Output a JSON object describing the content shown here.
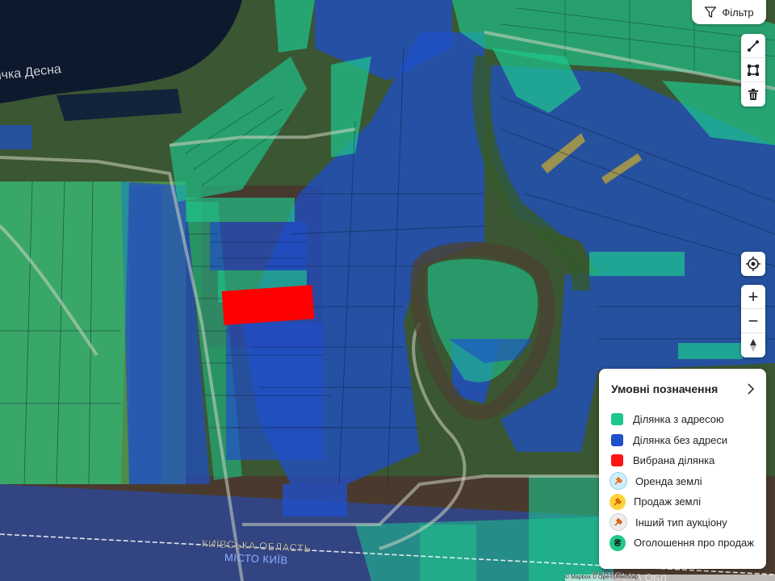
{
  "map": {
    "place_labels": {
      "river": "ічка Десна",
      "region": "КИЇВСЬКА ОБЛАСТЬ",
      "city": "МІСТО КИЇВ",
      "region_bottom": "КИЇВСЬКА ОБЛ"
    },
    "colors": {
      "with_address": "#1ec78e",
      "without_address": "#1f4fc9",
      "selected": "#ff0000"
    }
  },
  "toolbar": {
    "filter_label": "Фільтр",
    "filter_icon": "funnel-icon",
    "draw_icons": [
      "line-tool-icon",
      "polygon-tool-icon",
      "trash-icon"
    ],
    "locate_icon": "crosshair-icon",
    "zoom_in": "+",
    "zoom_out": "−",
    "compass_icon": "compass-icon"
  },
  "legend": {
    "title": "Умовні позначення",
    "items": [
      {
        "label": "Ділянка з адресою",
        "color": "#1ec78e",
        "kind": "swatch"
      },
      {
        "label": "Ділянка без адреси",
        "color": "#1f4fc9",
        "kind": "swatch"
      },
      {
        "label": "Вибрана ділянка",
        "color": "#ff1414",
        "kind": "swatch"
      },
      {
        "label": "Оренда землі",
        "color": "#8fd3f0",
        "kind": "rent-icon"
      },
      {
        "label": "Продаж землі",
        "color": "#f5b800",
        "kind": "sale-icon"
      },
      {
        "label": "Інший тип аукціону",
        "color": "#d9d9d9",
        "kind": "auction-icon"
      },
      {
        "label": "Оголошення про продаж",
        "color": "#21c98a",
        "kind": "hryvnia-icon"
      }
    ]
  },
  "attribution": "© Mapbox © OpenStreetMap"
}
